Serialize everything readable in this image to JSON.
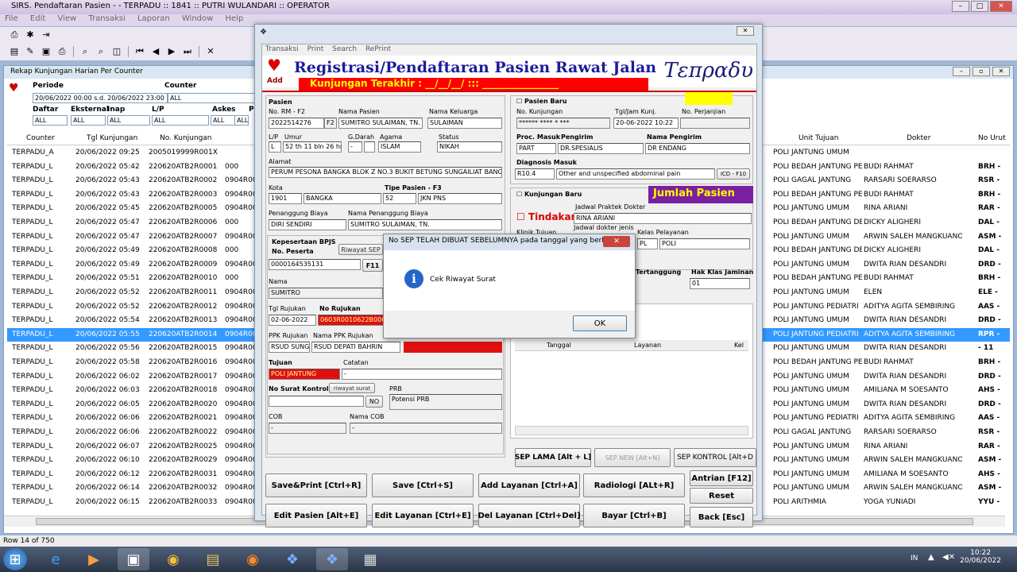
{
  "window": {
    "title": "SIRS. Pendaftaran Pasien -  - TERPADU  ::  1841  ::  PUTRI WULANDARI  ::  OPERATOR"
  },
  "menu": [
    "File",
    "Edit",
    "View",
    "Transaksi",
    "Laporan",
    "Window",
    "Help"
  ],
  "rekap": {
    "title": "Rekap Kunjungan Harian Per Counter",
    "periode_label": "Periode",
    "periode_value": "20/06/2022 00:00  s.d. 20/06/2022 23:00",
    "counter_label": "Counter",
    "counter_value": "ALL",
    "filters": [
      {
        "label": "Daftar",
        "value": "ALL"
      },
      {
        "label": "Eksternal",
        "value": "ALL"
      },
      {
        "label": "Inap",
        "value": "ALL"
      },
      {
        "label": "L/P",
        "value": "ALL"
      },
      {
        "label": "Askes",
        "value": "ALL"
      },
      {
        "label": "Pe",
        "value": "ALL"
      }
    ],
    "headers": [
      "Counter",
      "Tgl Kunjungan",
      "No. Kunjungan",
      "Unit Tujuan",
      "Dokter",
      "No Urut"
    ],
    "rows": [
      {
        "c": "TERPADU_A",
        "t": "20/06/2022 09:25",
        "n": "2005019999R001X",
        "r": "",
        "u": "POLI JANTUNG UMUM",
        "d": "",
        "k": ""
      },
      {
        "c": "TERPADU_L",
        "t": "20/06/2022 05:42",
        "n": "220620ATB2R0001",
        "r": "000",
        "u": "POLI BEDAH JANTUNG PE",
        "d": "BUDI RAHMAT",
        "k": "BRH - "
      },
      {
        "c": "TERPADU_L",
        "t": "20/06/2022 05:43",
        "n": "220620ATB2R0002",
        "r": "0904R00",
        "u": "POLI GAGAL JANTUNG",
        "d": "RARSARI SOERARSO",
        "k": "RSR - "
      },
      {
        "c": "TERPADU_L",
        "t": "20/06/2022 05:43",
        "n": "220620ATB2R0003",
        "r": "0904R00",
        "u": "POLI BEDAH JANTUNG PE",
        "d": "BUDI RAHMAT",
        "k": "BRH - "
      },
      {
        "c": "TERPADU_L",
        "t": "20/06/2022 05:45",
        "n": "220620ATB2R0005",
        "r": "0904R00",
        "u": "POLI JANTUNG UMUM",
        "d": "RINA ARIANI",
        "k": "RAR - "
      },
      {
        "c": "TERPADU_L",
        "t": "20/06/2022 05:47",
        "n": "220620ATB2R0006",
        "r": "000",
        "u": "POLI BEDAH JANTUNG DE",
        "d": "DICKY ALIGHERI",
        "k": "DAL - "
      },
      {
        "c": "TERPADU_L",
        "t": "20/06/2022 05:47",
        "n": "220620ATB2R0007",
        "r": "0904R00",
        "u": "POLI JANTUNG UMUM",
        "d": "ARWIN SALEH MANGKUANOM",
        "k": "ASM - "
      },
      {
        "c": "TERPADU_L",
        "t": "20/06/2022 05:49",
        "n": "220620ATB2R0008",
        "r": "000",
        "u": "POLI BEDAH JANTUNG DE",
        "d": "DICKY ALIGHERI",
        "k": "DAL - "
      },
      {
        "c": "TERPADU_L",
        "t": "20/06/2022 05:49",
        "n": "220620ATB2R0009",
        "r": "0904R00",
        "u": "POLI JANTUNG UMUM",
        "d": "DWITA RIAN DESANDRI",
        "k": "DRD - "
      },
      {
        "c": "TERPADU_L",
        "t": "20/06/2022 05:51",
        "n": "220620ATB2R0010",
        "r": "000",
        "u": "POLI BEDAH JANTUNG PE",
        "d": "BUDI RAHMAT",
        "k": "BRH - "
      },
      {
        "c": "TERPADU_L",
        "t": "20/06/2022 05:52",
        "n": "220620ATB2R0011",
        "r": "0904R00",
        "u": "POLI JANTUNG UMUM",
        "d": "ELEN",
        "k": "ELE - "
      },
      {
        "c": "TERPADU_L",
        "t": "20/06/2022 05:52",
        "n": "220620ATB2R0012",
        "r": "0904R00",
        "u": "POLI JANTUNG PEDIATRI",
        "d": "ADITYA AGITA SEMBIRING",
        "k": "AAS - "
      },
      {
        "c": "TERPADU_L",
        "t": "20/06/2022 05:54",
        "n": "220620ATB2R0013",
        "r": "0904R00",
        "u": "POLI JANTUNG UMUM",
        "d": "DWITA RIAN DESANDRI",
        "k": "DRD - "
      },
      {
        "c": "TERPADU_L",
        "t": "20/06/2022 05:55",
        "n": "220620ATB2R0014",
        "r": "0904R00",
        "u": "POLI JANTUNG PEDIATRI",
        "d": "ADITYA AGITA SEMBIRING",
        "k": "RPR - ",
        "sel": true
      },
      {
        "c": "TERPADU_L",
        "t": "20/06/2022 05:56",
        "n": "220620ATB2R0015",
        "r": "0904R00",
        "u": "POLI JANTUNG UMUM",
        "d": "DWITA RIAN DESANDRI",
        "k": " - 11"
      },
      {
        "c": "TERPADU_L",
        "t": "20/06/2022 05:58",
        "n": "220620ATB2R0016",
        "r": "0904R00",
        "u": "POLI BEDAH JANTUNG PE",
        "d": "BUDI RAHMAT",
        "k": "BRH - "
      },
      {
        "c": "TERPADU_L",
        "t": "20/06/2022 06:02",
        "n": "220620ATB2R0017",
        "r": "0904R00",
        "u": "POLI JANTUNG UMUM",
        "d": "DWITA RIAN DESANDRI",
        "k": "DRD - "
      },
      {
        "c": "TERPADU_L",
        "t": "20/06/2022 06:03",
        "n": "220620ATB2R0018",
        "r": "0904R00",
        "u": "POLI JANTUNG UMUM",
        "d": "AMILIANA M SOESANTO",
        "k": "AHS - "
      },
      {
        "c": "TERPADU_L",
        "t": "20/06/2022 06:05",
        "n": "220620ATB2R0020",
        "r": "0904R00",
        "u": "POLI JANTUNG UMUM",
        "d": "DWITA RIAN DESANDRI",
        "k": "DRD - "
      },
      {
        "c": "TERPADU_L",
        "t": "20/06/2022 06:06",
        "n": "220620ATB2R0021",
        "r": "0904R00",
        "u": "POLI JANTUNG PEDIATRI",
        "d": "ADITYA AGITA SEMBIRING",
        "k": "AAS - "
      },
      {
        "c": "TERPADU_L",
        "t": "20/06/2022 06:06",
        "n": "220620ATB2R0022",
        "r": "0904R00",
        "u": "POLI GAGAL JANTUNG",
        "d": "RARSARI SOERARSO",
        "k": "RSR - "
      },
      {
        "c": "TERPADU_L",
        "t": "20/06/2022 06:07",
        "n": "220620ATB2R0025",
        "r": "0904R00",
        "u": "POLI JANTUNG UMUM",
        "d": "RINA ARIANI",
        "k": "RAR - "
      },
      {
        "c": "TERPADU_L",
        "t": "20/06/2022 06:10",
        "n": "220620ATB2R0029",
        "r": "0904R00",
        "u": "POLI JANTUNG UMUM",
        "d": "ARWIN SALEH MANGKUANOM",
        "k": "ASM - "
      },
      {
        "c": "TERPADU_L",
        "t": "20/06/2022 06:12",
        "n": "220620ATB2R0031",
        "r": "0904R00",
        "u": "POLI JANTUNG UMUM",
        "d": "AMILIANA M SOESANTO",
        "k": "AHS - "
      },
      {
        "c": "TERPADU_L",
        "t": "20/06/2022 06:14",
        "n": "220620ATB2R0032",
        "r": "0904R00",
        "u": "POLI JANTUNG UMUM",
        "d": "ARWIN SALEH MANGKUANOM",
        "k": "ASM - "
      },
      {
        "c": "TERPADU_L",
        "t": "20/06/2022 06:15",
        "n": "220620ATB2R0033",
        "r": "0904R00",
        "u": "POLI ARITHMIA",
        "d": "YOGA YUNIADI",
        "k": "YYU - "
      }
    ],
    "status": "Row 14 of 750"
  },
  "form": {
    "menu": [
      "Transaksi",
      "Print",
      "Search",
      "RePrint"
    ],
    "add": "Add",
    "title": "Registrasi/Pendaftaran Pasien Rawat Jalan",
    "last_visit": "Kunjungan Terakhir  :  __/__/__/  :::  ________________",
    "brand": "Τεπραδυ",
    "pasien_label": "Pasien",
    "no_rm_label": "No. RM - F2",
    "no_rm": "2022514276",
    "f2": "F2",
    "nama_pasien_label": "Nama Pasien",
    "nama_pasien": "SUMITRO SULAIMAN, TN.",
    "nama_keluarga_label": "Nama Keluarga",
    "nama_keluarga": "SULAIMAN",
    "lp_label": "L/P",
    "lp": "L",
    "umur_label": "Umur",
    "umur": "52 th 11 bln 26 hr",
    "gdarah_label": "G.Darah",
    "gdarah": "-",
    "agama_label": "Agama",
    "agama": "ISLAM",
    "status_label": "Status",
    "status": "NIKAH",
    "alamat_label": "Alamat",
    "alamat": "PERUM PESONA BANGKA BLOK Z NO.3 BUKIT BETUNG SUNGAILIAT BANGKA E",
    "kota_label": "Kota",
    "kota_code": "1901",
    "kota": "BANGKA",
    "tipe_label": "Tipe Pasien - F3",
    "tipe_code": "52",
    "tipe": "JKN PNS",
    "pj_label": "Penanggung Biaya",
    "pj": "DIRI SENDIRI",
    "npj_label": "Nama Penanggung Biaya",
    "npj": "SUMITRO SULAIMAN, TN.",
    "bpjs_label": "Kepesertaan BPJS",
    "peserta_label": "No. Peserta",
    "peserta": "0000164535131",
    "f11": "F11",
    "riwayat_sep": "Riwayat SEP",
    "nama_label": "Nama",
    "nama": "SUMITRO",
    "tgl_rujukan_label": "Tgl Rujukan",
    "tgl_rujukan": "02-06-2022",
    "no_rujukan_label": "No Rujukan",
    "no_rujukan": "0603R0010622B000",
    "ppk_label": "PPK Rujukan",
    "ppk": "RSUD SUNGAILIAT",
    "nama_ppk_label": "Nama PPK Rujukan",
    "nama_ppk": "RSUD DEPATI BAHRIN",
    "tujuan_label": "Tujuan",
    "tujuan": "POLI JANTUNG",
    "catatan_label": "Catatan",
    "catatan": "-",
    "no_surat_label": "No Surat Kontrol",
    "riwayat_surat": "riwayat surat",
    "no_btn": "NO",
    "prb_label": "PRB",
    "prb": "Potensi PRB",
    "cob_label": "COB",
    "cob": "-",
    "nama_cob_label": "Nama COB",
    "nama_cob": "-",
    "pasien_baru": "Pasien Baru",
    "no_kunjungan_label": "No. Kunjungan",
    "no_kunjungan": "****** **** * ***",
    "tgl_kunj_label": "Tgl/Jam Kunj.",
    "tgl_kunj": "20-06-2022 10:22",
    "perjanjian_label": "No. Perjanjian",
    "proc_label": "Proc. Masuk",
    "proc": "PART",
    "pengirim_label": "Pengirim",
    "pengirim": "DR.SPESIALIS",
    "nama_pengirim_label": "Nama Pengirim",
    "nama_pengirim": "DR ENDANG",
    "diag_label": "Diagnosis Masuk",
    "diag_code": "R10.4",
    "diag": "Other and unspecified abdominal pain",
    "icd": "ICD - F10",
    "kunj_baru": "Kunjungan Baru",
    "jumlah": "Jumlah Pasien",
    "tindakan": "Tindakan",
    "jadwal_label": "Jadwal Praktek Dokter",
    "jadwal": "RINA ARIANI",
    "klinik_label": "Klinik Tujuan",
    "jadwal_jenis": "Jadwal dokter jenis",
    "kelas_label": "Kelas Pelayanan",
    "kelas": "POLI",
    "kelas_code": "PL",
    "tertanggung": "Tertanggung",
    "hak_label": "Hak Klas Jaminan",
    "hak": "01",
    "tbl_tanggal": "Tanggal",
    "tbl_layanan": "Layanan",
    "tbl_kel": "Kel",
    "sep_lama": "SEP LAMA [Alt + L]",
    "sep_new": "SEP NEW [Alt+N]",
    "sep_kontrol": "SEP KONTROL [Alt+D",
    "btns": {
      "save_print": "Save&Print [Ctrl+R]",
      "save": "Save [Ctrl+S]",
      "add_layanan": "Add Layanan [Ctrl+A]",
      "radiologi": "Radiologi [ALt+R]",
      "antrian": "Antrian [F12]",
      "reset": "Reset",
      "edit_pasien": "Edit Pasien [Alt+E]",
      "edit_layanan": "Edit Layanan [Ctrl+E]",
      "del_layanan": "Del Layanan [Ctrl+Del]",
      "bayar": "Bayar [Ctrl+B]",
      "back": "Back [Esc]"
    }
  },
  "message": {
    "title": "No SEP TELAH DIBUAT SEBELUMNYA pada tanggal yang berb...",
    "text": "Cek Riwayat Surat",
    "ok": "OK",
    "close": "✕"
  },
  "taskbar": {
    "time": "10:22",
    "date": "20/06/2022",
    "lang": "IN"
  }
}
